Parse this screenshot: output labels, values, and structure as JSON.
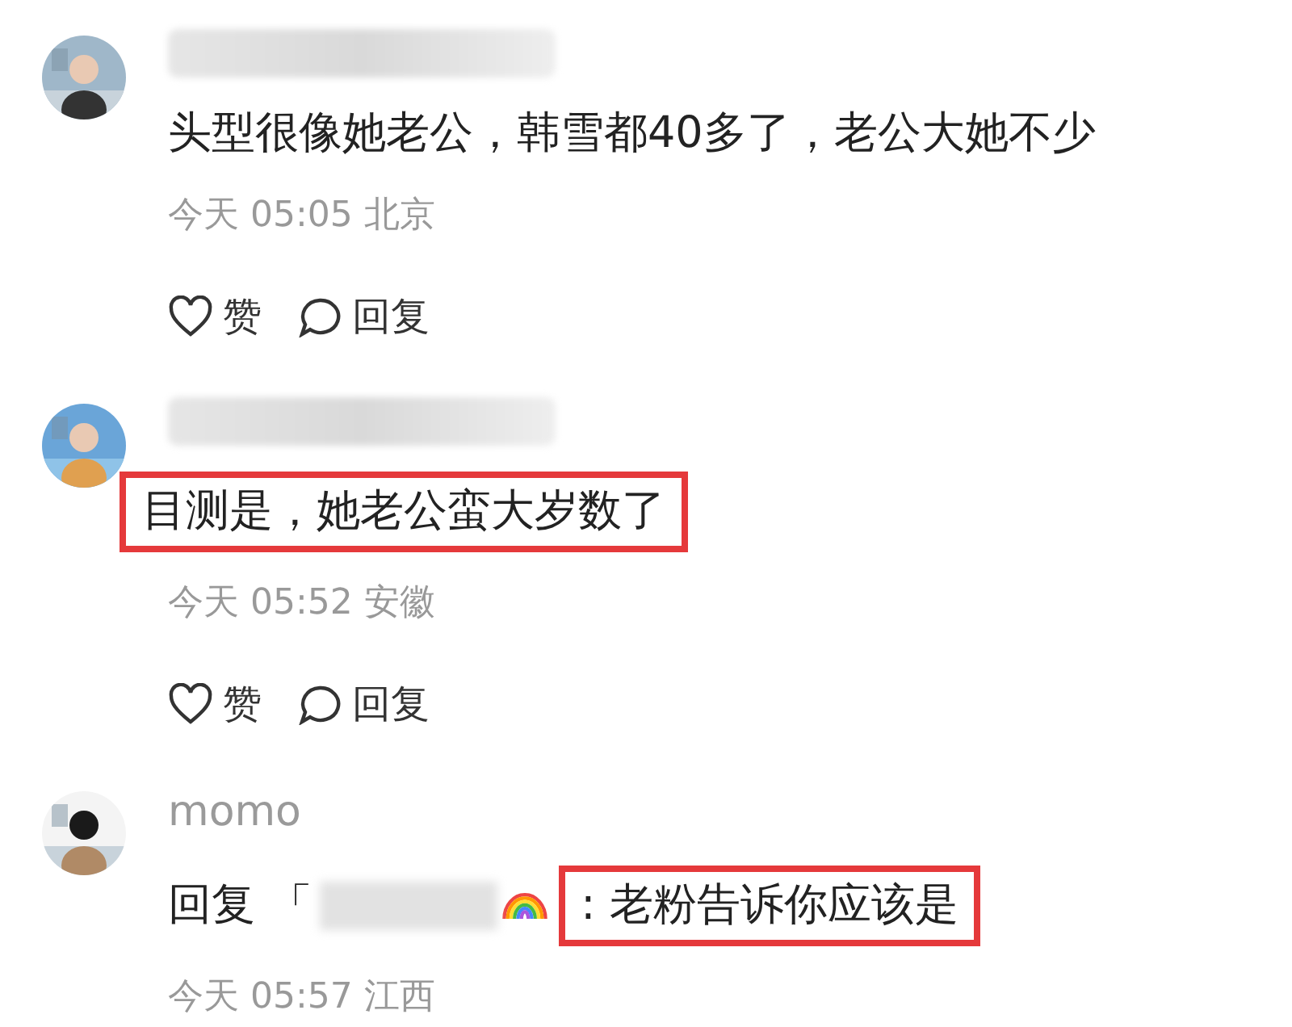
{
  "comments": [
    {
      "name_hidden": true,
      "text": "头型很像她老公，韩雪都40多了，老公大她不少",
      "highlighted": false,
      "meta": "今天 05:05 北京",
      "actions": [
        {
          "kind": "like",
          "label": "赞"
        },
        {
          "kind": "reply",
          "label": "回复"
        }
      ]
    },
    {
      "name_hidden": true,
      "text": "目测是，她老公蛮大岁数了",
      "highlighted": true,
      "meta": "今天 05:52 安徽",
      "actions": [
        {
          "kind": "like",
          "label": "赞"
        },
        {
          "kind": "reply",
          "label": "回复"
        }
      ]
    },
    {
      "name": "momo",
      "name_hidden": false,
      "reply_prefix": "回复 「",
      "text": ": 老粉告诉你应该是",
      "highlighted": true,
      "meta": "今天 05:57 江西"
    }
  ]
}
